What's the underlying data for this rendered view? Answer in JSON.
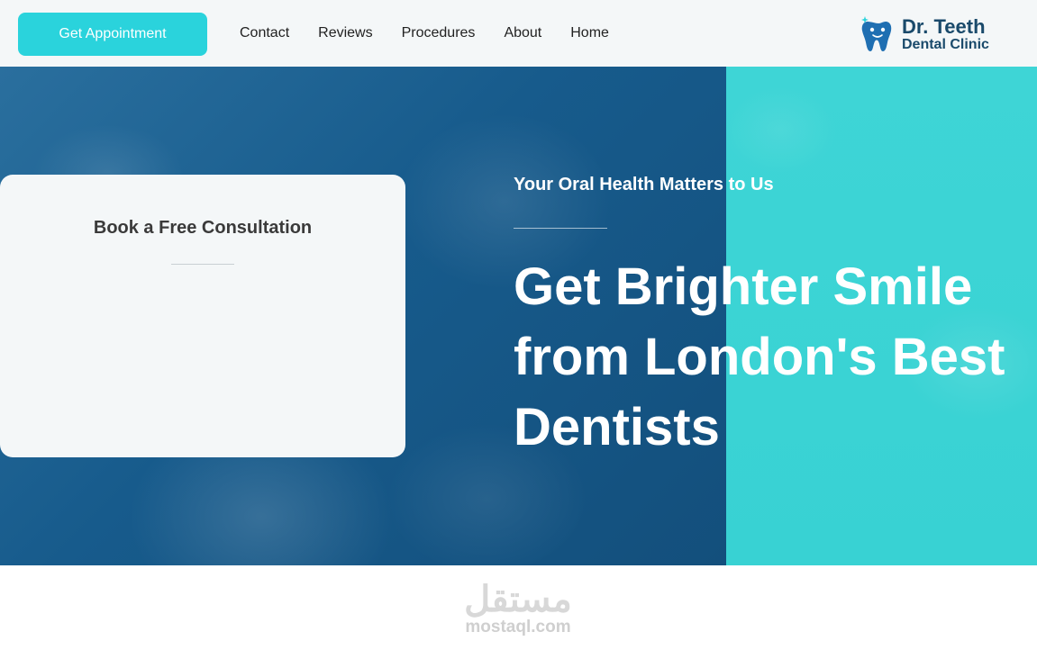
{
  "header": {
    "cta_label": "Get Appointment",
    "nav": [
      {
        "label": "Contact"
      },
      {
        "label": "Reviews"
      },
      {
        "label": "Procedures"
      },
      {
        "label": "About"
      },
      {
        "label": "Home"
      }
    ],
    "logo": {
      "title": "Dr. Teeth",
      "subtitle": "Dental Clinic",
      "icon": "tooth-icon"
    }
  },
  "hero": {
    "card_title": "Book a Free Consultation",
    "tagline": "Your Oral Health Matters to Us",
    "headline_lines": [
      "Get Brighter Smile",
      "from London's Best",
      "Dentists"
    ]
  },
  "watermark": {
    "arabic": "مستقل",
    "latin": "mostaql.com"
  },
  "colors": {
    "accent": "#2ad3dc",
    "hero_blue": "#175b8c",
    "hero_cyan": "#3ed5d6",
    "brand_navy": "#1a4a6b"
  }
}
